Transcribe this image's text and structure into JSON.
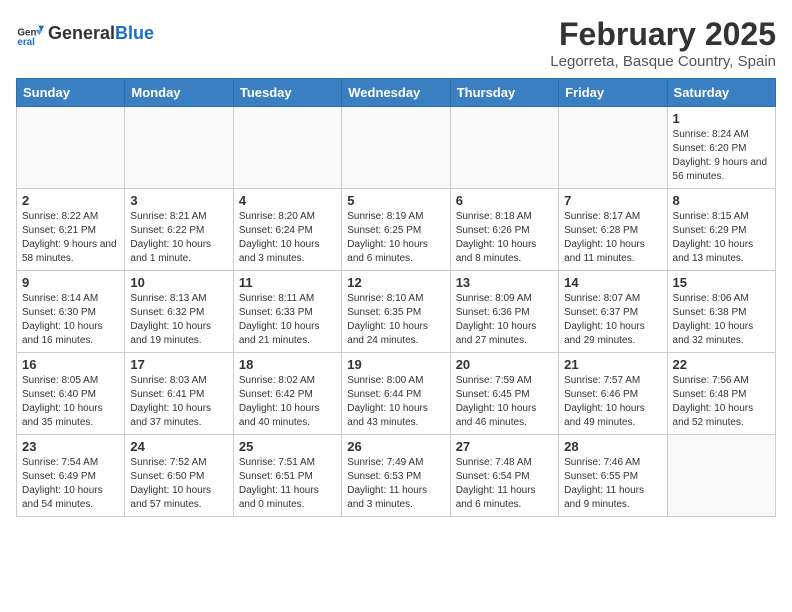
{
  "header": {
    "logo_general": "General",
    "logo_blue": "Blue",
    "main_title": "February 2025",
    "subtitle": "Legorreta, Basque Country, Spain"
  },
  "days_of_week": [
    "Sunday",
    "Monday",
    "Tuesday",
    "Wednesday",
    "Thursday",
    "Friday",
    "Saturday"
  ],
  "weeks": [
    [
      {
        "day": "",
        "info": ""
      },
      {
        "day": "",
        "info": ""
      },
      {
        "day": "",
        "info": ""
      },
      {
        "day": "",
        "info": ""
      },
      {
        "day": "",
        "info": ""
      },
      {
        "day": "",
        "info": ""
      },
      {
        "day": "1",
        "info": "Sunrise: 8:24 AM\nSunset: 6:20 PM\nDaylight: 9 hours and 56 minutes."
      }
    ],
    [
      {
        "day": "2",
        "info": "Sunrise: 8:22 AM\nSunset: 6:21 PM\nDaylight: 9 hours and 58 minutes."
      },
      {
        "day": "3",
        "info": "Sunrise: 8:21 AM\nSunset: 6:22 PM\nDaylight: 10 hours and 1 minute."
      },
      {
        "day": "4",
        "info": "Sunrise: 8:20 AM\nSunset: 6:24 PM\nDaylight: 10 hours and 3 minutes."
      },
      {
        "day": "5",
        "info": "Sunrise: 8:19 AM\nSunset: 6:25 PM\nDaylight: 10 hours and 6 minutes."
      },
      {
        "day": "6",
        "info": "Sunrise: 8:18 AM\nSunset: 6:26 PM\nDaylight: 10 hours and 8 minutes."
      },
      {
        "day": "7",
        "info": "Sunrise: 8:17 AM\nSunset: 6:28 PM\nDaylight: 10 hours and 11 minutes."
      },
      {
        "day": "8",
        "info": "Sunrise: 8:15 AM\nSunset: 6:29 PM\nDaylight: 10 hours and 13 minutes."
      }
    ],
    [
      {
        "day": "9",
        "info": "Sunrise: 8:14 AM\nSunset: 6:30 PM\nDaylight: 10 hours and 16 minutes."
      },
      {
        "day": "10",
        "info": "Sunrise: 8:13 AM\nSunset: 6:32 PM\nDaylight: 10 hours and 19 minutes."
      },
      {
        "day": "11",
        "info": "Sunrise: 8:11 AM\nSunset: 6:33 PM\nDaylight: 10 hours and 21 minutes."
      },
      {
        "day": "12",
        "info": "Sunrise: 8:10 AM\nSunset: 6:35 PM\nDaylight: 10 hours and 24 minutes."
      },
      {
        "day": "13",
        "info": "Sunrise: 8:09 AM\nSunset: 6:36 PM\nDaylight: 10 hours and 27 minutes."
      },
      {
        "day": "14",
        "info": "Sunrise: 8:07 AM\nSunset: 6:37 PM\nDaylight: 10 hours and 29 minutes."
      },
      {
        "day": "15",
        "info": "Sunrise: 8:06 AM\nSunset: 6:38 PM\nDaylight: 10 hours and 32 minutes."
      }
    ],
    [
      {
        "day": "16",
        "info": "Sunrise: 8:05 AM\nSunset: 6:40 PM\nDaylight: 10 hours and 35 minutes."
      },
      {
        "day": "17",
        "info": "Sunrise: 8:03 AM\nSunset: 6:41 PM\nDaylight: 10 hours and 37 minutes."
      },
      {
        "day": "18",
        "info": "Sunrise: 8:02 AM\nSunset: 6:42 PM\nDaylight: 10 hours and 40 minutes."
      },
      {
        "day": "19",
        "info": "Sunrise: 8:00 AM\nSunset: 6:44 PM\nDaylight: 10 hours and 43 minutes."
      },
      {
        "day": "20",
        "info": "Sunrise: 7:59 AM\nSunset: 6:45 PM\nDaylight: 10 hours and 46 minutes."
      },
      {
        "day": "21",
        "info": "Sunrise: 7:57 AM\nSunset: 6:46 PM\nDaylight: 10 hours and 49 minutes."
      },
      {
        "day": "22",
        "info": "Sunrise: 7:56 AM\nSunset: 6:48 PM\nDaylight: 10 hours and 52 minutes."
      }
    ],
    [
      {
        "day": "23",
        "info": "Sunrise: 7:54 AM\nSunset: 6:49 PM\nDaylight: 10 hours and 54 minutes."
      },
      {
        "day": "24",
        "info": "Sunrise: 7:52 AM\nSunset: 6:50 PM\nDaylight: 10 hours and 57 minutes."
      },
      {
        "day": "25",
        "info": "Sunrise: 7:51 AM\nSunset: 6:51 PM\nDaylight: 11 hours and 0 minutes."
      },
      {
        "day": "26",
        "info": "Sunrise: 7:49 AM\nSunset: 6:53 PM\nDaylight: 11 hours and 3 minutes."
      },
      {
        "day": "27",
        "info": "Sunrise: 7:48 AM\nSunset: 6:54 PM\nDaylight: 11 hours and 6 minutes."
      },
      {
        "day": "28",
        "info": "Sunrise: 7:46 AM\nSunset: 6:55 PM\nDaylight: 11 hours and 9 minutes."
      },
      {
        "day": "",
        "info": ""
      }
    ]
  ]
}
